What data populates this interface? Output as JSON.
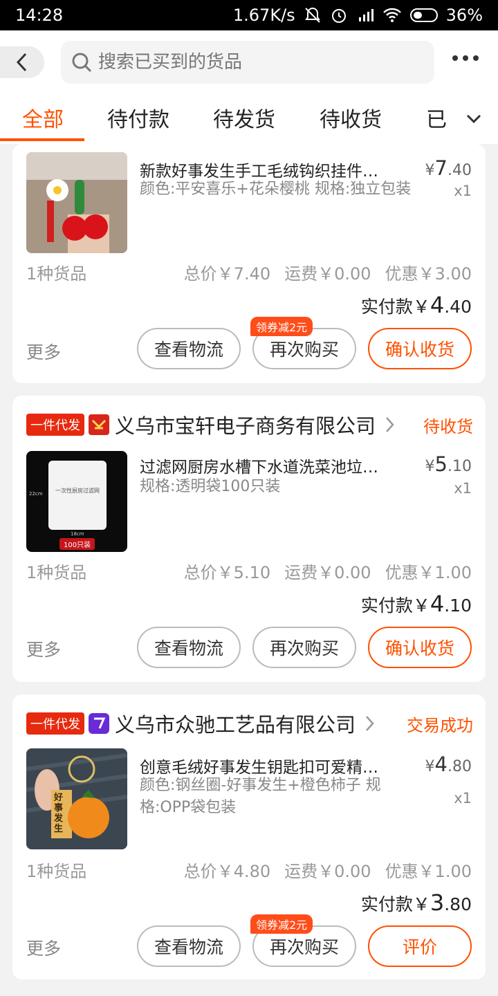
{
  "status": {
    "time": "14:28",
    "speed": "1.67K/s",
    "battery": "36%"
  },
  "search": {
    "placeholder": "搜索已买到的货品"
  },
  "tabs": [
    {
      "label": "全部"
    },
    {
      "label": "待付款"
    },
    {
      "label": "待发货"
    },
    {
      "label": "待收货"
    },
    {
      "label": "已"
    }
  ],
  "orders": [
    {
      "title": "新款好事发生手工毛绒钩织挂件…",
      "spec": "颜色:平安喜乐+花朵樱桃 规格:独立包装",
      "price_yen": "¥",
      "price_int": "7",
      "price_dec": ".40",
      "qty": "x1",
      "count": "1种货品",
      "total": "总价￥7.40",
      "shipping": "运费￥0.00",
      "discount": "优惠￥3.00",
      "paid_label": "实付款",
      "paid_yen": "￥",
      "paid_int": "4",
      "paid_dec": ".40",
      "more": "更多",
      "btn1": "查看物流",
      "btn2": "再次购买",
      "btn3": "确认收货",
      "coupon": "领券减2元"
    },
    {
      "badge": "一件代发",
      "shop": "义乌市宝轩电子商务有限公司",
      "status": "待收货",
      "title": "过滤网厨房水槽下水道洗菜池垃…",
      "spec": "规格:透明袋100只装",
      "price_yen": "¥",
      "price_int": "5",
      "price_dec": ".10",
      "qty": "x1",
      "count": "1种货品",
      "total": "总价￥5.10",
      "shipping": "运费￥0.00",
      "discount": "优惠￥1.00",
      "paid_label": "实付款",
      "paid_yen": "￥",
      "paid_int": "4",
      "paid_dec": ".10",
      "more": "更多",
      "btn1": "查看物流",
      "btn2": "再次购买",
      "btn3": "确认收货",
      "thumb_text": "一次性厨房过滤网",
      "thumb_tag": "100只装",
      "thumb_h": "22cm",
      "thumb_w": "18cm"
    },
    {
      "badge": "一件代发",
      "shop": "义乌市众驰工艺品有限公司",
      "status": "交易成功",
      "title": "创意毛绒好事发生钥匙扣可爱精…",
      "spec": "颜色:钢丝圈-好事发生+橙色柿子 规格:OPP袋包装",
      "price_yen": "¥",
      "price_int": "4",
      "price_dec": ".80",
      "qty": "x1",
      "count": "1种货品",
      "total": "总价￥4.80",
      "shipping": "运费￥0.00",
      "discount": "优惠￥1.00",
      "paid_label": "实付款",
      "paid_yen": "￥",
      "paid_int": "3",
      "paid_dec": ".80",
      "more": "更多",
      "btn1": "查看物流",
      "btn2": "再次购买",
      "btn3": "评价",
      "coupon": "领券减2元",
      "thumb_tag": "好事发生"
    }
  ],
  "colors": {
    "accent": "#ff5000",
    "badge": "#e72a0f"
  }
}
